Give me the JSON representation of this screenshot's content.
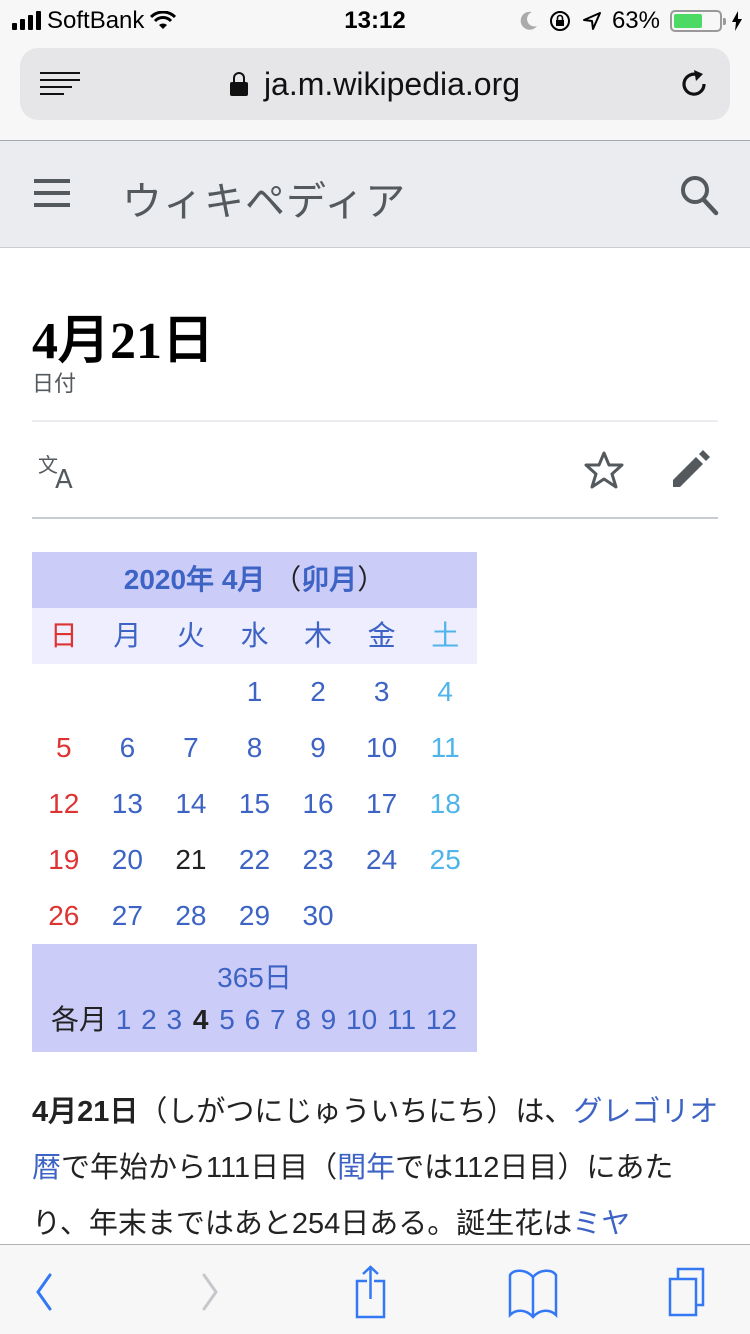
{
  "status_bar": {
    "carrier": "SoftBank",
    "time": "13:12",
    "battery_percent": "63%",
    "battery_level": 0.63
  },
  "browser": {
    "url": "ja.m.wikipedia.org",
    "icons": [
      "reader-icon",
      "lock-icon",
      "reload-icon"
    ],
    "toolbar_icons": [
      "back-icon",
      "forward-icon",
      "share-icon",
      "bookmarks-icon",
      "tabs-icon"
    ]
  },
  "wiki_header": {
    "wordmark": "ウィキペディア",
    "icons": [
      "menu-icon",
      "search-icon"
    ]
  },
  "page": {
    "title": "4月21日",
    "description": "日付",
    "action_icons": [
      "language-icon",
      "watch-star-icon",
      "edit-pencil-icon"
    ]
  },
  "calendar": {
    "year_label": "2020年",
    "month_label": "4月",
    "paren_open": "（",
    "eto": "卯月",
    "paren_close": "）",
    "weekdays": [
      "日",
      "月",
      "火",
      "水",
      "木",
      "金",
      "土"
    ],
    "weeks": [
      [
        "",
        "",
        "",
        "1",
        "2",
        "3",
        "4"
      ],
      [
        "5",
        "6",
        "7",
        "8",
        "9",
        "10",
        "11"
      ],
      [
        "12",
        "13",
        "14",
        "15",
        "16",
        "17",
        "18"
      ],
      [
        "19",
        "20",
        "21",
        "22",
        "23",
        "24",
        "25"
      ],
      [
        "26",
        "27",
        "28",
        "29",
        "30",
        "",
        ""
      ]
    ],
    "today": "21",
    "days_link": "365日",
    "months_label": "各月",
    "months": [
      "1",
      "2",
      "3",
      "4",
      "5",
      "6",
      "7",
      "8",
      "9",
      "10",
      "11",
      "12"
    ],
    "current_month": "4",
    "colors": {
      "header_bg": "#ccccf8",
      "dow_bg": "#eeeefe",
      "link": "#3d63c4",
      "sunday": "#dd3333",
      "saturday": "#4fb4ea"
    }
  },
  "article": {
    "bold_title": "4月21日",
    "t1": "（しがつにじゅういちにち）は、",
    "link1": "グレゴリオ暦",
    "t2": "で年始から111日目（",
    "link2": "閏年",
    "t3": "では112日目）にあたり、年末まではあと254日ある。誕生花は",
    "link3": "ミヤ"
  }
}
